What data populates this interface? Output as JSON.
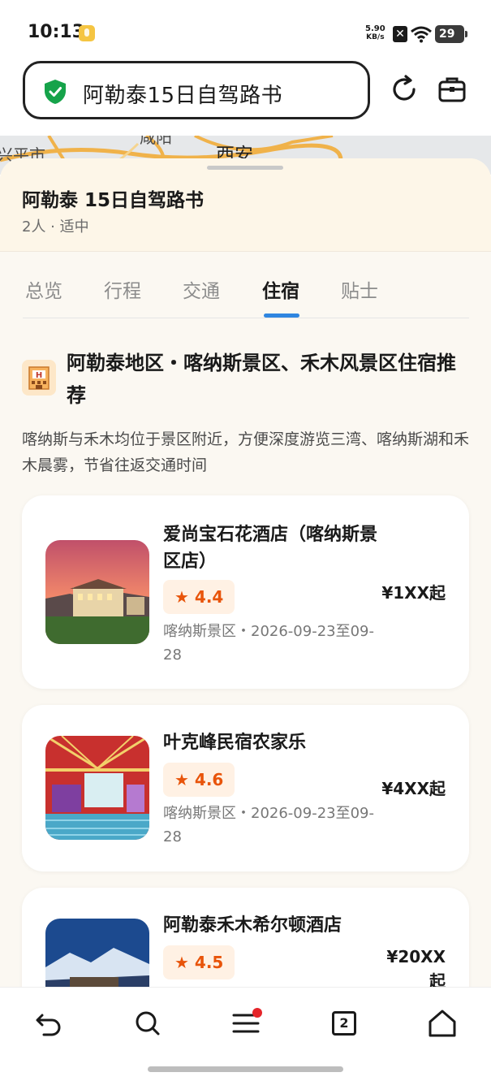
{
  "status_bar": {
    "time": "10:13",
    "net_speed_value": "5.90",
    "net_speed_unit": "KB/s",
    "battery": "29"
  },
  "top_bar": {
    "search_text": "阿勒泰15日自驾路书",
    "accent_color": "#16a34a"
  },
  "map": {
    "labels": [
      "兴平市",
      "咸阳",
      "西安"
    ]
  },
  "plan": {
    "title": "阿勒泰 15日自驾路书",
    "meta": "2人 · 适中"
  },
  "tabs": [
    {
      "label": "总览",
      "active": false
    },
    {
      "label": "行程",
      "active": false
    },
    {
      "label": "交通",
      "active": false
    },
    {
      "label": "住宿",
      "active": true
    },
    {
      "label": "贴士",
      "active": false
    }
  ],
  "section": {
    "icon": "hotel-icon",
    "title": "阿勒泰地区・喀纳斯景区、禾木风景区住宿推荐",
    "description": "喀纳斯与禾木均位于景区附近，方便深度游览三湾、喀纳斯湖和禾木晨雾，节省往返交通时间"
  },
  "hotels": [
    {
      "name": "爱尚宝石花酒店（喀纳斯景区店）",
      "rating": "4.4",
      "location": "喀纳斯景区・2026-09-23至09-28",
      "price": "¥1XX起"
    },
    {
      "name": "叶克峰民宿农家乐",
      "rating": "4.6",
      "location": "喀纳斯景区・2026-09-23至09-28",
      "price": "¥4XX起"
    },
    {
      "name": "阿勒泰禾木希尔顿酒店",
      "rating": "4.5",
      "location": "",
      "price": "¥20XX起"
    }
  ],
  "bottom_nav": {
    "tab_count": "2",
    "menu_has_badge": true,
    "badge_color": "#e5252a"
  }
}
